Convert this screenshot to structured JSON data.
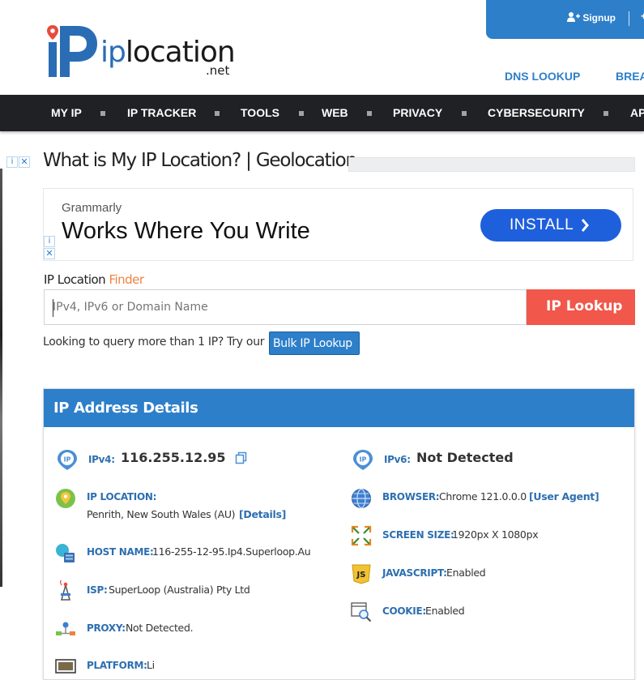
{
  "header": {
    "logo_ip": "ip",
    "logo_location": "location",
    "logo_suffix": ".net",
    "signup_label": "Signup",
    "signup_more": "+",
    "links": [
      "DNS LOOKUP",
      "BREA"
    ]
  },
  "nav": {
    "items": [
      "MY IP",
      "IP TRACKER",
      "TOOLS",
      "WEB",
      "PRIVACY",
      "CYBERSECURITY",
      "AP"
    ]
  },
  "page": {
    "title": "What is My IP Location? | Geolocation"
  },
  "ad": {
    "brand": "Grammarly",
    "headline": "Works Where You Write",
    "cta": "INSTALL",
    "adchoice_symbol": "i",
    "close_symbol": "✕"
  },
  "finder": {
    "label_main": "IP Location ",
    "label_accent": "Finder",
    "placeholder": "IPv4, IPv6 or Domain Name",
    "button": "IP Lookup",
    "bulk_text": "Looking to query more than 1 IP? Try our",
    "bulk_button": "Bulk IP Lookup"
  },
  "details": {
    "title": "IP Address Details",
    "ipv4_label": "IPv4:",
    "ipv4_value": "116.255.12.95",
    "ipv6_label": "IPv6:",
    "ipv6_value": "Not Detected",
    "location_label": "IP LOCATION:",
    "location_value": "Penrith, New South Wales (AU)",
    "location_link": "[Details]",
    "browser_label": "BROWSER:",
    "browser_value": "Chrome 121.0.0.0",
    "browser_link": "[User Agent]",
    "host_label": "HOST NAME:",
    "host_value": "116-255-12-95.Ip4.Superloop.Au",
    "screen_label": "SCREEN SIZE:",
    "screen_value": "1920px X 1080px",
    "isp_label": "ISP:",
    "isp_value": "SuperLoop (Australia) Pty Ltd",
    "js_label": "JAVASCRIPT:",
    "js_value": "Enabled",
    "proxy_label": "PROXY:",
    "proxy_value": "Not Detected.",
    "cookie_label": "COOKIE:",
    "cookie_value": "Enabled",
    "platform_label": "PLATFORM:",
    "platform_value": "Li"
  },
  "colors": {
    "brand_blue": "#2d7fc9",
    "nav_dark": "#1f2124",
    "lookup_red": "#f1574a",
    "accent_orange": "#f0823c"
  }
}
